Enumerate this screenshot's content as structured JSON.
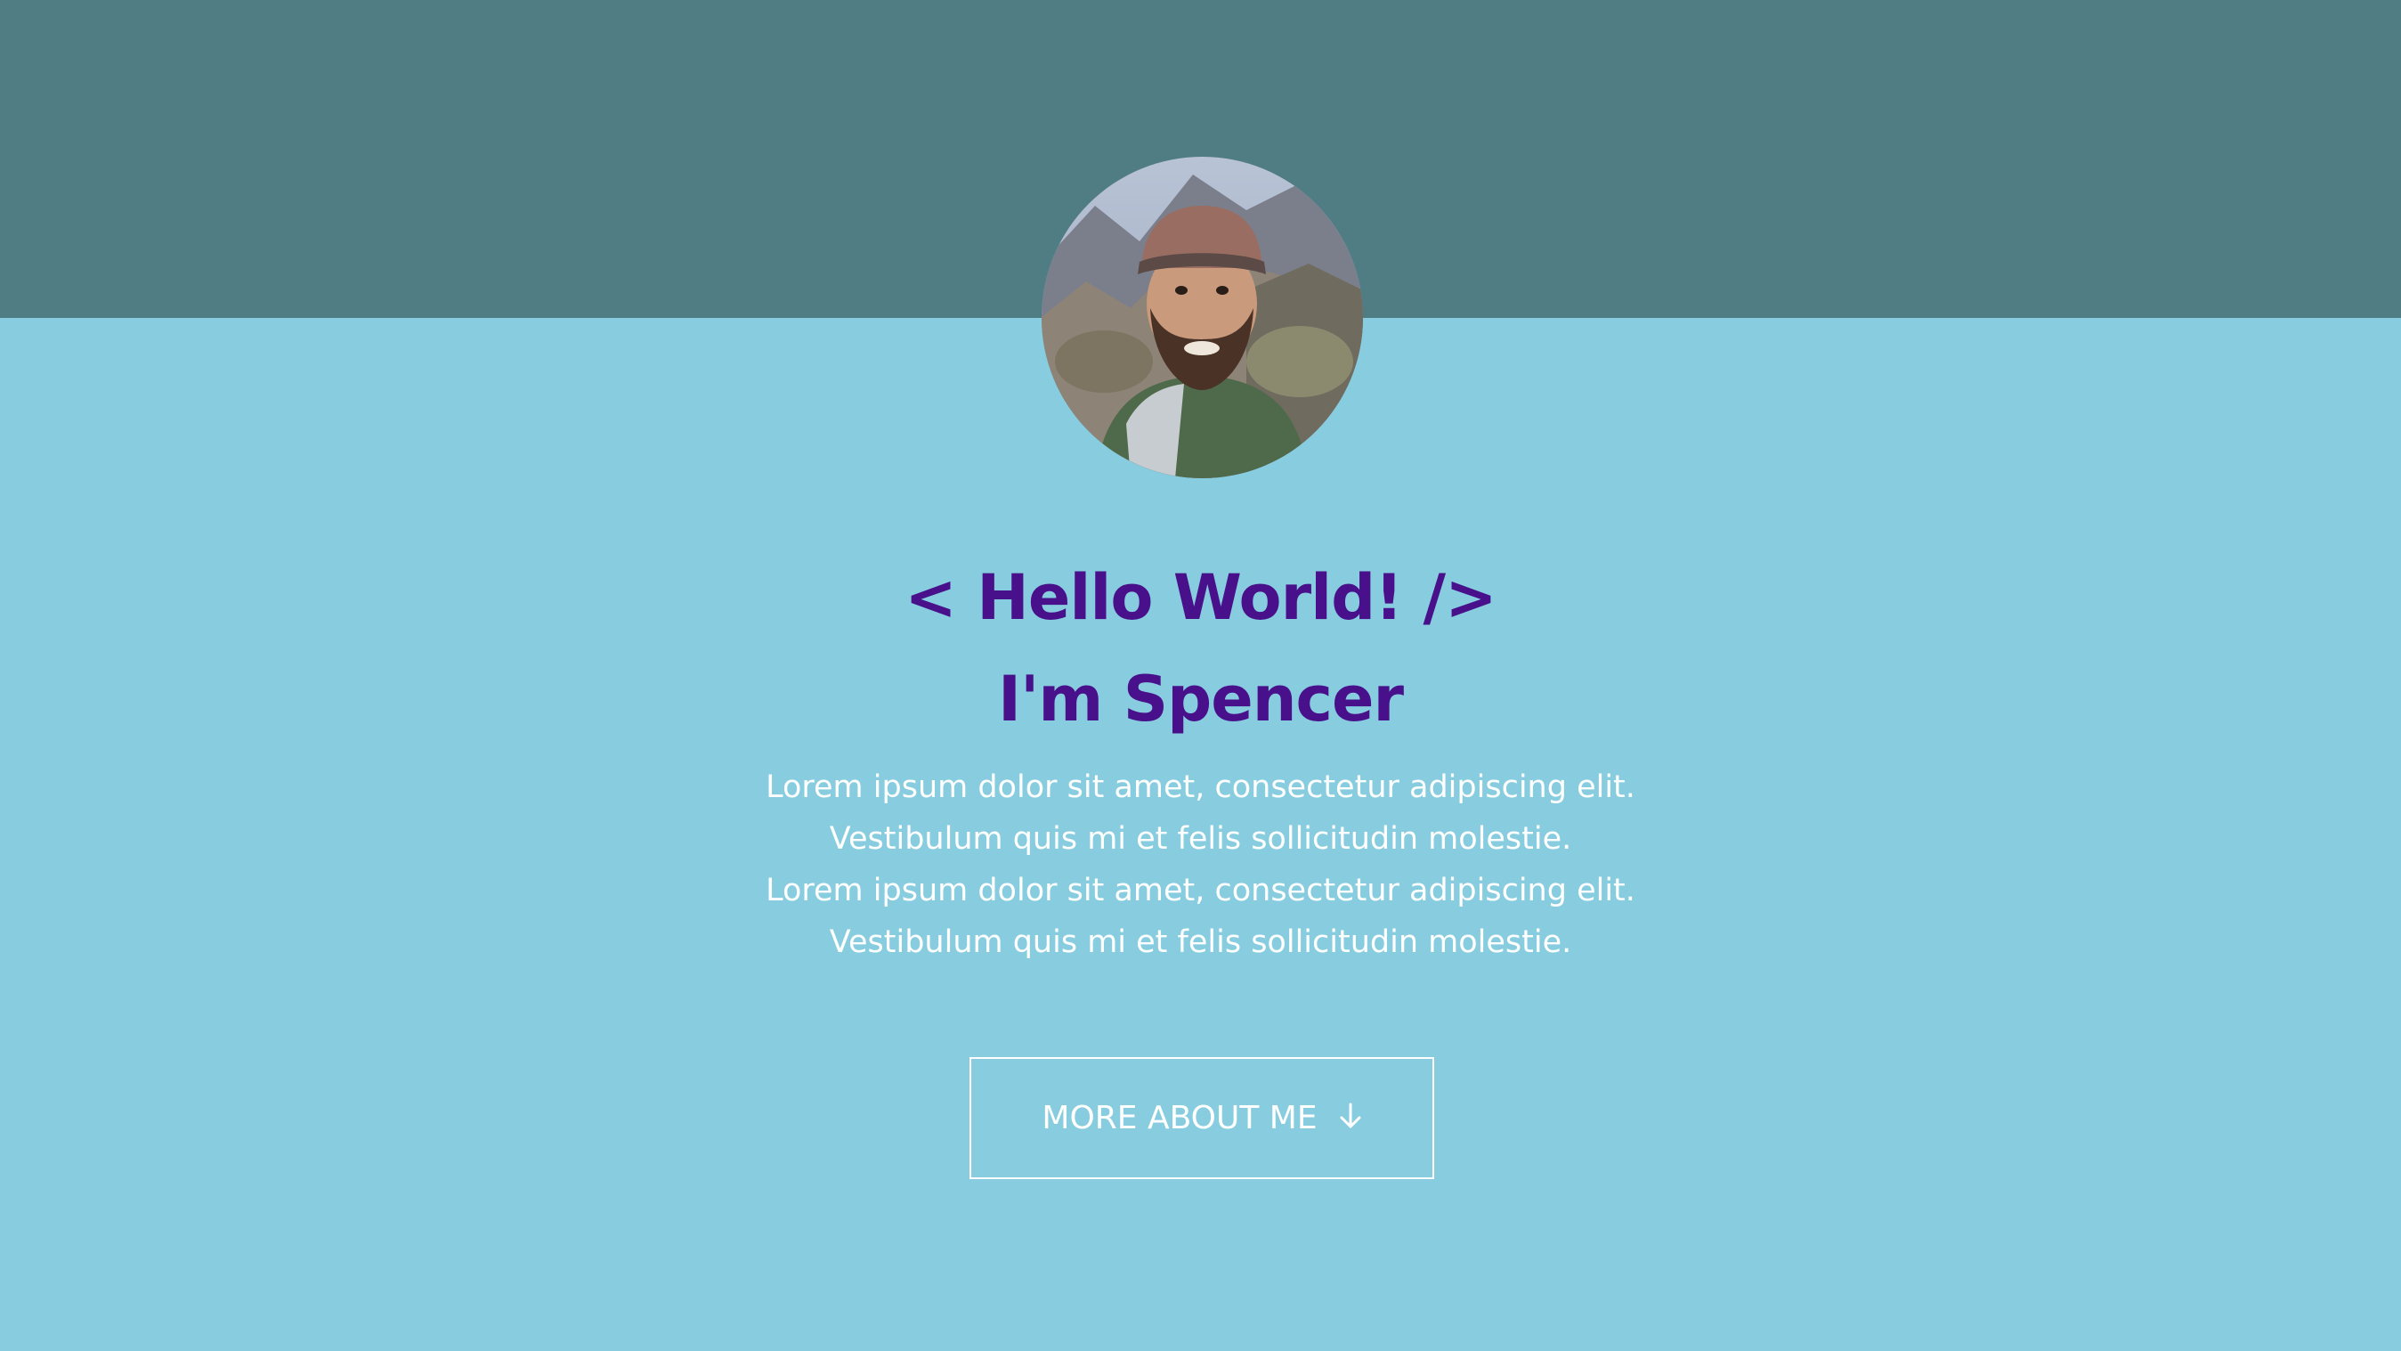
{
  "header": {
    "avatar_icon": "profile-photo"
  },
  "hero": {
    "greeting": "< Hello World! />",
    "name": "I'm Spencer",
    "bio_lines": [
      "Lorem ipsum dolor sit amet, consectetur adipiscing elit.",
      "Vestibulum quis mi et felis sollicitudin molestie.",
      "Lorem ipsum dolor sit amet, consectetur adipiscing elit.",
      "Vestibulum quis mi et felis sollicitudin molestie."
    ]
  },
  "cta": {
    "label": "MORE ABOUT ME",
    "icon": "arrow-down-icon"
  },
  "colors": {
    "top_band": "#507c84",
    "background": "#87cddf",
    "heading": "#48108a",
    "text": "#ffffff"
  }
}
